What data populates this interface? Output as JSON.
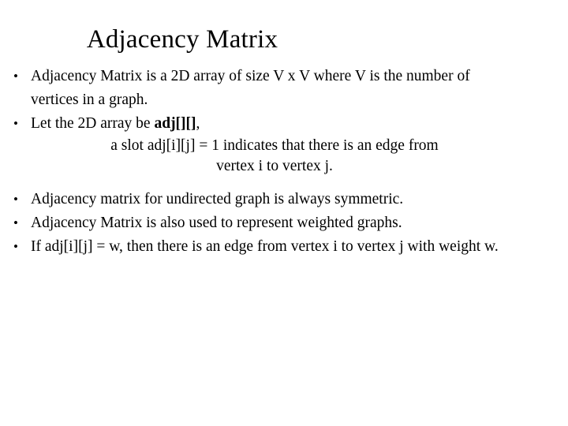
{
  "slide": {
    "background_color": "#ffffff",
    "text_color": "#000000",
    "title": "Adjacency Matrix",
    "bullets": [
      {
        "id": "bullet-definition",
        "text": "Adjacency Matrix is a 2D array of size V x V where V is the number of vertices in a graph."
      },
      {
        "id": "bullet-array-name",
        "text_before": "Let the 2D array be ",
        "code": "adj[][]",
        "text_after": ","
      },
      {
        "id": "bullet-symmetric",
        "text": "Adjacency matrix for undirected graph is always symmetric."
      },
      {
        "id": "bullet-weighted",
        "text": "Adjacency Matrix is also used to represent weighted graphs."
      },
      {
        "id": "bullet-weight-value",
        "text": "If adj[i][j] = w, then there is an edge from vertex i to vertex j with weight w."
      }
    ],
    "centered_note": {
      "line1": "a slot adj[i][j] = 1 indicates that there is an edge from",
      "line2": "vertex i to vertex j."
    }
  }
}
